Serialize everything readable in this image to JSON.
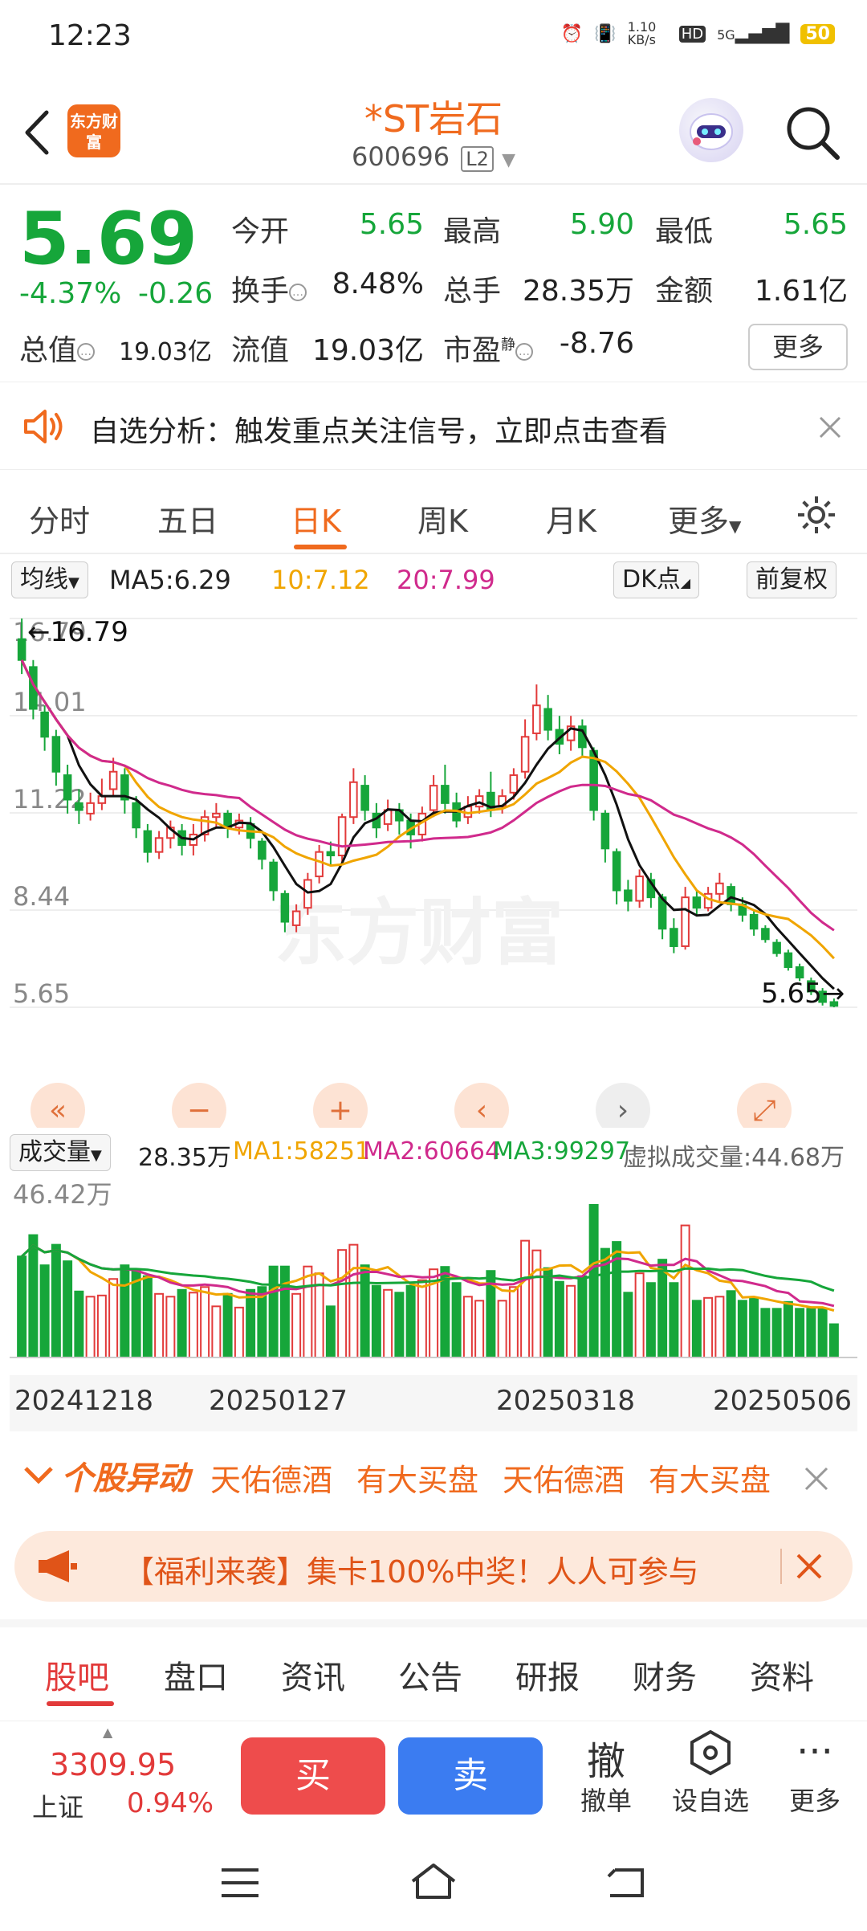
{
  "status_bar": {
    "time": "12:23",
    "net_speed": "1.10 KB/s",
    "network": "5G",
    "hd": "HD",
    "battery": "50"
  },
  "header": {
    "stock_name": "*ST岩石",
    "stock_code": "600696",
    "level_tag": "L2",
    "logo_text": "东方财富"
  },
  "quote": {
    "price": "5.69",
    "change_pct": "-4.37%",
    "change": "-0.26",
    "open_label": "今开",
    "open": "5.65",
    "high_label": "最高",
    "high": "5.90",
    "low_label": "最低",
    "low": "5.65",
    "turnover_label": "换手",
    "turnover": "8.48%",
    "volume_label": "总手",
    "volume": "28.35万",
    "amount_label": "金额",
    "amount": "1.61亿",
    "mktcap_label": "总值",
    "mktcap": "19.03亿",
    "float_label": "流值",
    "float": "19.03亿",
    "pe_label": "市盈",
    "pe_tag": "静",
    "pe": "-8.76",
    "more_label": "更多"
  },
  "banner": {
    "text": "自选分析：触发重点关注信号，立即点击查看"
  },
  "chart_tabs": [
    "分时",
    "五日",
    "日K",
    "周K",
    "月K",
    "更多"
  ],
  "ma_bar": {
    "type_label": "均线",
    "ma5": "MA5:6.29",
    "ma10": "10:7.12",
    "ma20": "20:7.99",
    "dk_label": "DK点",
    "adjust_label": "前复权"
  },
  "kline": {
    "y_labels": [
      "16.79",
      "14.01",
      "11.22",
      "8.44",
      "5.65"
    ],
    "max_marker": "16.79",
    "min_marker": "5.65",
    "watermark": "东方财富"
  },
  "volume_bar": {
    "label": "成交量",
    "vol": "28.35万",
    "ma1": "MA1:58251",
    "ma2": "MA2:60664",
    "ma3": "MA3:99297",
    "virtual": "虚拟成交量:44.68万",
    "max_label": "46.42万"
  },
  "dates": [
    "20241218",
    "20250127",
    "20250318",
    "20250506"
  ],
  "movement": {
    "title": "个股异动",
    "items": [
      "天佑德酒",
      "有大买盘",
      "天佑德酒",
      "有大买盘"
    ]
  },
  "promo": {
    "text": "【福利来袭】集卡100%中奖！人人可参与"
  },
  "bottom_tabs": [
    "股吧",
    "盘口",
    "资讯",
    "公告",
    "研报",
    "财务",
    "资料"
  ],
  "action_bar": {
    "index_value": "3309.95",
    "index_name": "上证",
    "index_pct": "0.94%",
    "buy": "买",
    "sell": "卖",
    "cancel_icon": "撤",
    "cancel_label": "撤单",
    "watch_label": "设自选",
    "more_label": "更多"
  },
  "colors": {
    "up": "#e23a3a",
    "down": "#16a63a",
    "accent": "#f06a1e",
    "sell": "#3b7cf1"
  },
  "chart_data": {
    "type": "candlestick",
    "price_range": [
      5.65,
      16.79
    ],
    "candles": [
      [
        16.2,
        15.6,
        16.79,
        15.2
      ],
      [
        15.4,
        14.2,
        15.6,
        13.9
      ],
      [
        14.1,
        13.4,
        14.3,
        13.0
      ],
      [
        13.4,
        12.4,
        13.6,
        12.0
      ],
      [
        12.3,
        11.6,
        12.6,
        11.2
      ],
      [
        11.5,
        11.3,
        11.9,
        10.9
      ],
      [
        11.2,
        11.5,
        11.8,
        11.0
      ],
      [
        11.5,
        11.7,
        12.2,
        11.3
      ],
      [
        11.9,
        12.4,
        12.8,
        11.7
      ],
      [
        12.3,
        11.6,
        12.5,
        11.2
      ],
      [
        11.5,
        10.8,
        11.7,
        10.5
      ],
      [
        10.7,
        10.1,
        10.9,
        9.8
      ],
      [
        10.1,
        10.5,
        10.7,
        9.9
      ],
      [
        10.5,
        10.8,
        11.0,
        10.2
      ],
      [
        10.7,
        10.3,
        10.9,
        10.0
      ],
      [
        10.3,
        10.6,
        10.9,
        10.0
      ],
      [
        10.6,
        11.1,
        11.3,
        10.4
      ],
      [
        11.1,
        11.2,
        11.5,
        10.8
      ],
      [
        11.2,
        10.8,
        11.3,
        10.5
      ],
      [
        10.8,
        11.0,
        11.2,
        10.6
      ],
      [
        10.9,
        10.5,
        11.1,
        10.2
      ],
      [
        10.4,
        9.9,
        10.5,
        9.6
      ],
      [
        9.8,
        9.0,
        9.9,
        8.7
      ],
      [
        8.9,
        8.1,
        9.0,
        7.8
      ],
      [
        8.0,
        8.4,
        8.6,
        7.8
      ],
      [
        8.5,
        9.3,
        9.5,
        8.3
      ],
      [
        9.4,
        10.1,
        10.3,
        9.2
      ],
      [
        10.1,
        10.0,
        10.4,
        9.7
      ],
      [
        10.0,
        11.1,
        11.2,
        9.8
      ],
      [
        11.1,
        12.1,
        12.5,
        10.9
      ],
      [
        12.0,
        11.3,
        12.3,
        11.0
      ],
      [
        11.2,
        10.8,
        11.5,
        10.5
      ],
      [
        10.9,
        11.3,
        11.6,
        10.7
      ],
      [
        11.3,
        11.0,
        11.5,
        10.6
      ],
      [
        11.0,
        10.6,
        11.2,
        10.2
      ],
      [
        10.6,
        11.2,
        11.4,
        10.4
      ],
      [
        11.3,
        12.0,
        12.3,
        11.1
      ],
      [
        12.0,
        11.5,
        12.6,
        11.2
      ],
      [
        11.5,
        11.0,
        11.8,
        10.8
      ],
      [
        11.1,
        11.4,
        11.7,
        10.9
      ],
      [
        11.4,
        11.7,
        11.9,
        11.2
      ],
      [
        11.8,
        11.3,
        12.4,
        11.1
      ],
      [
        11.4,
        11.7,
        11.9,
        11.2
      ],
      [
        11.8,
        12.3,
        12.5,
        11.6
      ],
      [
        12.4,
        13.4,
        13.9,
        12.2
      ],
      [
        13.5,
        14.3,
        14.9,
        13.3
      ],
      [
        14.2,
        13.6,
        14.6,
        13.3
      ],
      [
        13.6,
        13.2,
        14.0,
        12.9
      ],
      [
        13.3,
        13.7,
        14.0,
        13.0
      ],
      [
        13.7,
        13.1,
        13.9,
        12.8
      ],
      [
        13.0,
        11.3,
        13.1,
        11.0
      ],
      [
        11.2,
        10.2,
        11.3,
        9.8
      ],
      [
        10.1,
        9.0,
        10.2,
        8.6
      ],
      [
        9.0,
        8.7,
        9.3,
        8.4
      ],
      [
        8.7,
        9.4,
        9.6,
        8.5
      ],
      [
        9.3,
        8.8,
        9.5,
        8.5
      ],
      [
        8.8,
        7.9,
        8.9,
        7.6
      ],
      [
        7.9,
        7.4,
        8.2,
        7.2
      ],
      [
        7.4,
        8.8,
        9.1,
        7.3
      ],
      [
        8.8,
        8.5,
        9.0,
        8.3
      ],
      [
        8.5,
        8.9,
        9.1,
        8.4
      ],
      [
        8.9,
        9.2,
        9.5,
        8.7
      ],
      [
        9.1,
        8.6,
        9.2,
        8.4
      ],
      [
        8.6,
        8.3,
        8.8,
        8.1
      ],
      [
        8.3,
        7.9,
        8.4,
        7.7
      ],
      [
        7.9,
        7.6,
        8.0,
        7.5
      ],
      [
        7.5,
        7.2,
        7.6,
        7.1
      ],
      [
        7.2,
        6.8,
        7.3,
        6.7
      ],
      [
        6.8,
        6.5,
        6.9,
        6.4
      ],
      [
        6.4,
        6.1,
        6.5,
        6.0
      ],
      [
        6.1,
        5.8,
        6.2,
        5.7
      ],
      [
        5.8,
        5.69,
        5.9,
        5.65
      ]
    ],
    "ma5_last": 6.29,
    "ma10_last": 7.12,
    "ma20_last": 7.99,
    "volume_max": "46.42万"
  }
}
